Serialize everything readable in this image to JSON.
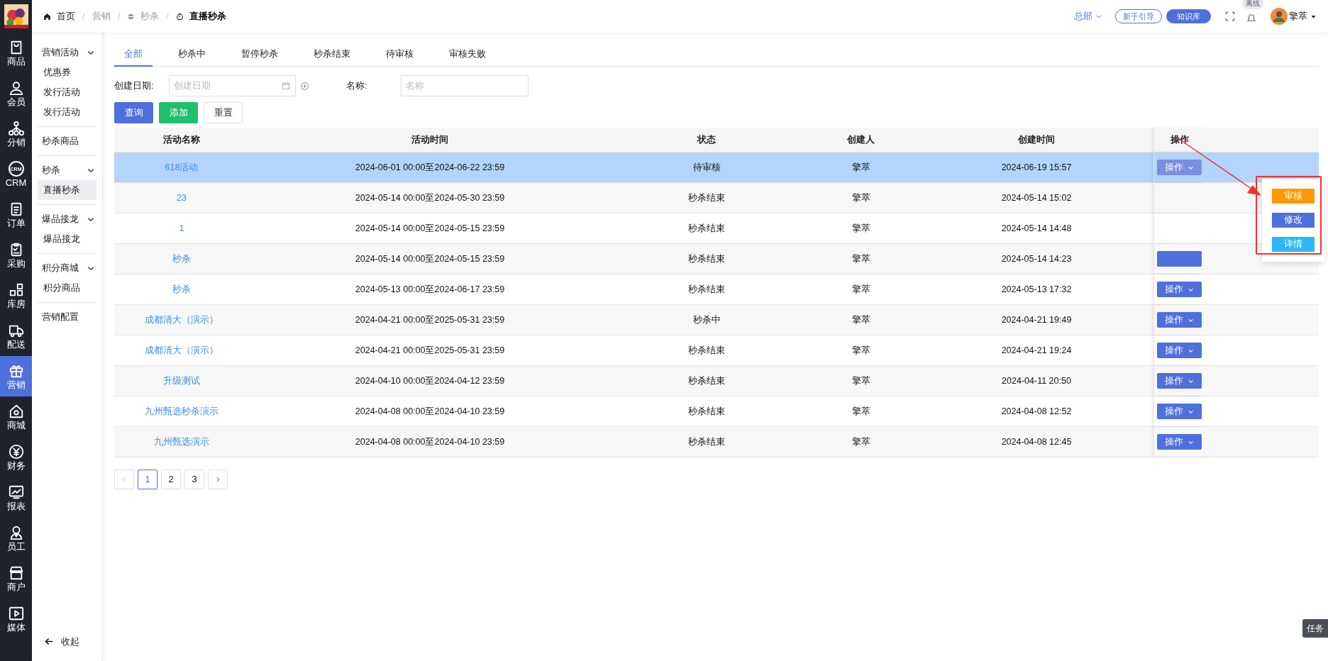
{
  "breadcrumb": [
    {
      "label": "首页",
      "current": false,
      "muted": false
    },
    {
      "separator": "/",
      "label": "营销",
      "current": false,
      "muted": true
    },
    {
      "separator": "/",
      "label": "秒杀",
      "current": false,
      "muted": true
    },
    {
      "separator": "/",
      "label": "直播秒杀",
      "current": true,
      "muted": false
    }
  ],
  "topbar": {
    "org": "总部",
    "guide_button": "新手引导",
    "kb_button": "知识库",
    "offline_badge": "离线",
    "user": "擎萃"
  },
  "rail": [
    {
      "label": "商品",
      "selected": false
    },
    {
      "label": "会员",
      "selected": false
    },
    {
      "label": "分销",
      "selected": false
    },
    {
      "label": "CRM",
      "icon_text": "CRM",
      "selected": false
    },
    {
      "label": "订单",
      "selected": false
    },
    {
      "label": "采购",
      "selected": false
    },
    {
      "label": "库房",
      "selected": false
    },
    {
      "label": "配送",
      "selected": false
    },
    {
      "label": "营销",
      "selected": true
    },
    {
      "label": "商城",
      "selected": false
    },
    {
      "label": "财务",
      "selected": false
    },
    {
      "label": "报表",
      "selected": false
    },
    {
      "label": "员工",
      "selected": false
    },
    {
      "label": "商户",
      "selected": false
    },
    {
      "label": "媒体",
      "selected": false
    }
  ],
  "submenu": [
    {
      "label": "营销活动",
      "expanded": true,
      "children": [
        {
          "label": "优惠券",
          "selected": false
        },
        {
          "label": "发行活动",
          "selected": false
        },
        {
          "label": "发行活动",
          "selected": false
        }
      ]
    },
    {
      "label": "秒杀商品"
    },
    {
      "label": "秒杀",
      "expanded": true,
      "children": [
        {
          "label": "直播秒杀",
          "selected": true
        }
      ]
    },
    {
      "label": "爆品接龙",
      "expanded": true,
      "children": [
        {
          "label": "爆品接龙",
          "selected": false
        }
      ]
    },
    {
      "label": "积分商城",
      "expanded": true,
      "children": [
        {
          "label": "积分商品",
          "selected": false
        }
      ]
    },
    {
      "label": "营销配置"
    }
  ],
  "collapse": "收起",
  "tabs": [
    {
      "label": "全部",
      "selected": true
    },
    {
      "label": "秒杀中",
      "selected": false
    },
    {
      "label": "暂停秒杀",
      "selected": false
    },
    {
      "label": "秒杀结束",
      "selected": false
    },
    {
      "label": "待审核",
      "selected": false
    },
    {
      "label": "审核失败",
      "selected": false
    }
  ],
  "filters": {
    "date_label": "创建日期:",
    "date_placeholder": "创建日期",
    "name_label": "名称:",
    "name_placeholder": "名称"
  },
  "buttons": [
    {
      "label": "查询",
      "kind": "primary"
    },
    {
      "label": "添加",
      "kind": "success"
    },
    {
      "label": "重置",
      "kind": "plain"
    }
  ],
  "table": {
    "columns": [
      "活动名称",
      "活动时间",
      "状态",
      "创建人",
      "创建时间",
      "操作"
    ],
    "rows": [
      {
        "name": "618活动",
        "time": "2024-06-01 00:00至2024-06-22 23:59",
        "status": "待审核",
        "creator": "擎萃",
        "created": "2024-06-19 15:57",
        "action": "操作",
        "selected": true
      },
      {
        "name": "23",
        "time": "2024-05-14 00:00至2024-05-30 23:59",
        "status": "秒杀结束",
        "creator": "擎萃",
        "created": "2024-05-14 15:02",
        "selected": false
      },
      {
        "name": "1",
        "time": "2024-05-14 00:00至2024-05-15 23:59",
        "status": "秒杀结束",
        "creator": "擎萃",
        "created": "2024-05-14 14:48",
        "selected": false
      },
      {
        "name": "秒杀",
        "time": "2024-05-14 00:00至2024-05-15 23:59",
        "status": "秒杀结束",
        "creator": "擎萃",
        "created": "2024-05-14 14:23",
        "action_covered": true,
        "selected": false
      },
      {
        "name": "秒杀",
        "time": "2024-05-13 00:00至2024-06-17 23:59",
        "status": "秒杀结束",
        "creator": "擎萃",
        "created": "2024-05-13 17:32",
        "action": "操作",
        "selected": false
      },
      {
        "name": "成都清大（演示）",
        "time": "2024-04-21 00:00至2025-05-31 23:59",
        "status": "秒杀中",
        "creator": "擎萃",
        "created": "2024-04-21 19:49",
        "action": "操作",
        "selected": false
      },
      {
        "name": "成都清大（演示）",
        "time": "2024-04-21 00:00至2025-05-31 23:59",
        "status": "秒杀结束",
        "creator": "擎萃",
        "created": "2024-04-21 19:24",
        "action": "操作",
        "selected": false
      },
      {
        "name": "升级测试",
        "time": "2024-04-10 00:00至2024-04-12 23:59",
        "status": "秒杀结束",
        "creator": "擎萃",
        "created": "2024-04-11 20:50",
        "action": "操作",
        "selected": false
      },
      {
        "name": "九州甄选秒杀演示",
        "time": "2024-04-08 00:00至2024-04-10 23:59",
        "status": "秒杀结束",
        "creator": "擎萃",
        "created": "2024-04-08 12:52",
        "action": "操作",
        "selected": false
      },
      {
        "name": "九州甄选演示",
        "time": "2024-04-08 00:00至2024-04-10 23:59",
        "status": "秒杀结束",
        "creator": "擎萃",
        "created": "2024-04-08 12:45",
        "action": "操作",
        "selected": false
      }
    ]
  },
  "action_menu": [
    {
      "label": "审核",
      "color": "#ff9900"
    },
    {
      "label": "修改",
      "color": "#4e6fdc"
    },
    {
      "label": "详情",
      "color": "#2db7f5"
    }
  ],
  "pagination": [
    {
      "label": "1",
      "selected": true
    },
    {
      "label": "2",
      "selected": false
    },
    {
      "label": "3",
      "selected": false
    }
  ],
  "task_tab": "任务"
}
